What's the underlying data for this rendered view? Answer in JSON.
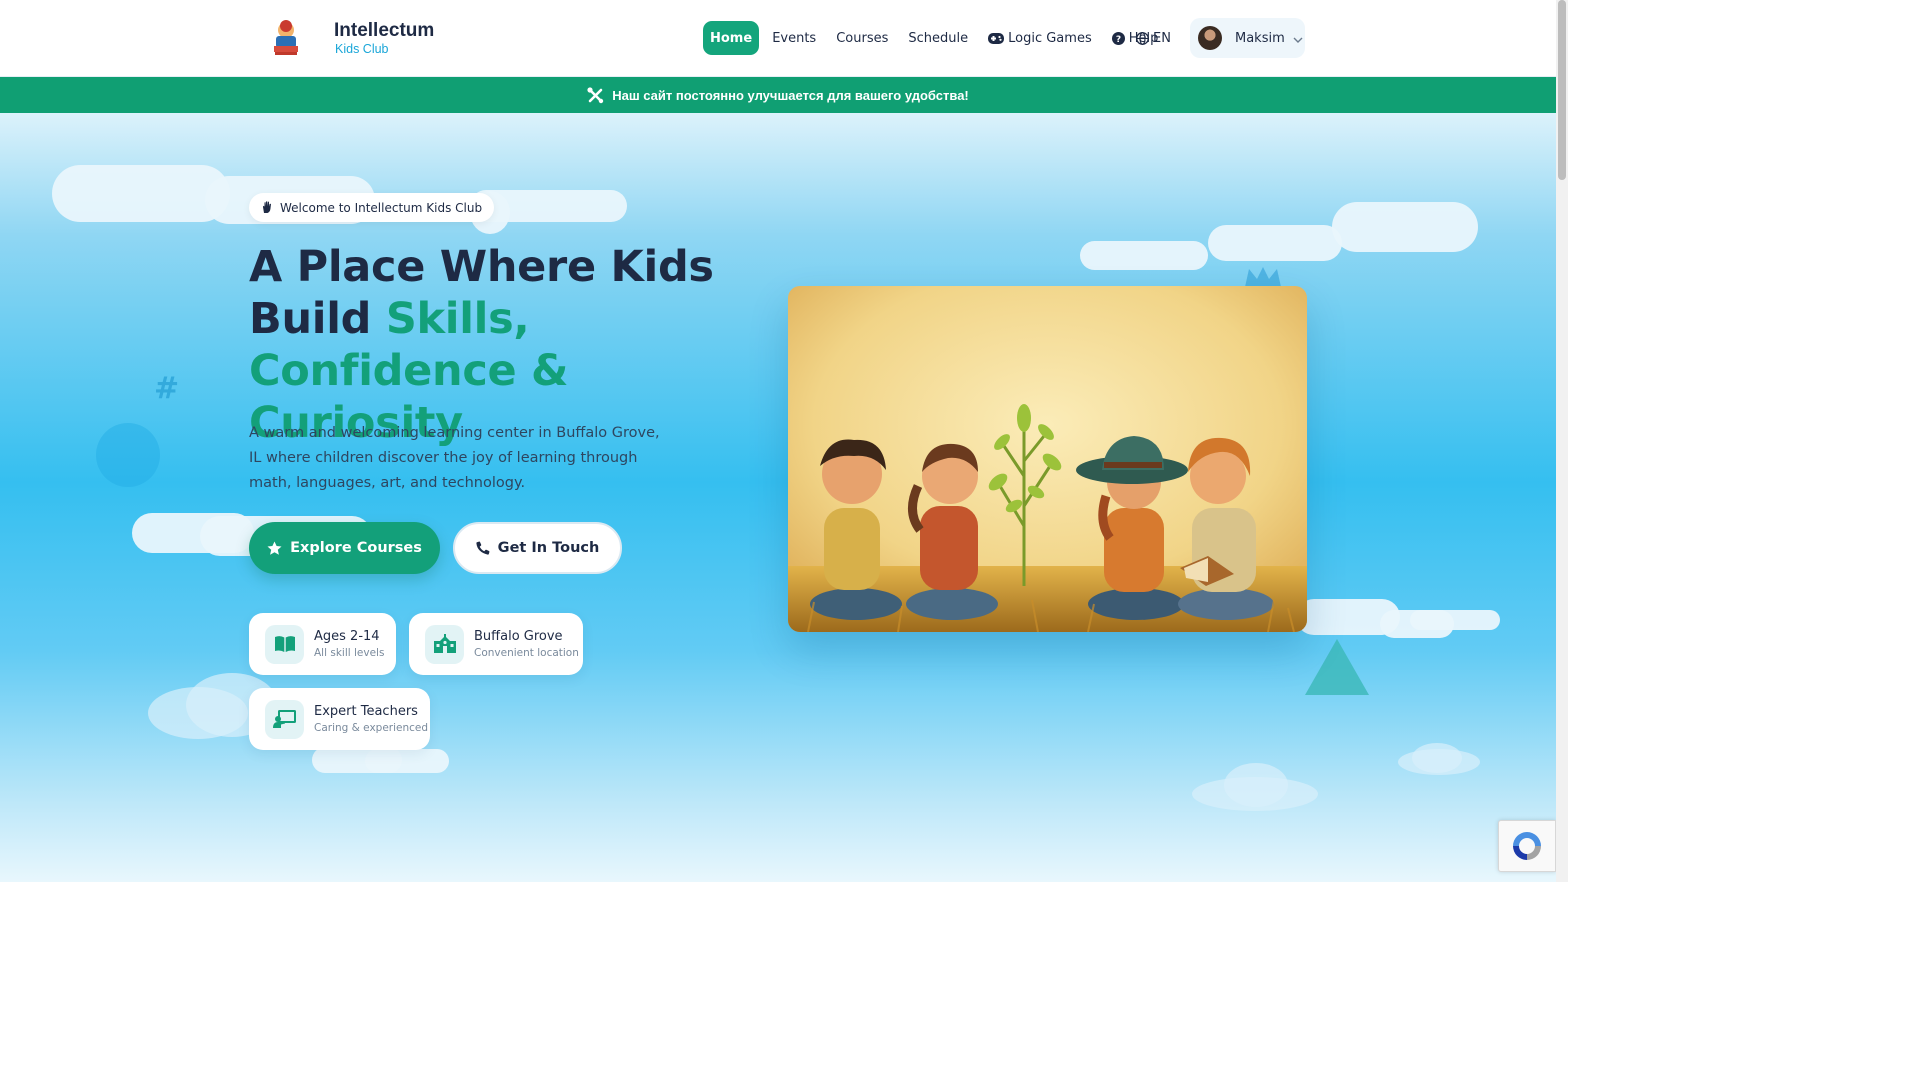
{
  "header": {
    "brand_title": "Intellectum",
    "brand_subtitle": "Kids Club",
    "nav": [
      {
        "label": "Home",
        "icon": ""
      },
      {
        "label": "Events",
        "icon": ""
      },
      {
        "label": "Courses",
        "icon": ""
      },
      {
        "label": "Schedule",
        "icon": ""
      },
      {
        "label": "Logic Games",
        "icon": "gamepad-icon"
      },
      {
        "label": "Help",
        "icon": "question-circle-icon"
      }
    ],
    "language": "EN",
    "user_name": "Maksim"
  },
  "banner": {
    "text": "Наш сайт постоянно улучшается для вашего удобства!",
    "icon": "tools-icon"
  },
  "hero": {
    "welcome": "Welcome to Intellectum Kids Club",
    "headline_part1": "A Place Where Kids Build ",
    "headline_accent": "Skills, Confidence & Curiosity",
    "lead": "A warm and welcoming learning center in Buffalo Grove, IL where children discover the joy of learning through math, languages, art, and technology.",
    "primary_cta": "Explore Courses",
    "secondary_cta": "Get In Touch",
    "features": [
      {
        "title": "Ages 2-14",
        "subtitle": "All skill levels",
        "icon": "book-open-icon"
      },
      {
        "title": "Buffalo Grove",
        "subtitle": "Convenient location",
        "icon": "school-icon"
      },
      {
        "title": "Expert Teachers",
        "subtitle": "Caring & experienced",
        "icon": "teacher-icon"
      }
    ]
  },
  "colors": {
    "primary": "#13a07a",
    "banner": "#109f73",
    "heading": "#1e2a44",
    "brand_sub": "#1aa6d8"
  }
}
